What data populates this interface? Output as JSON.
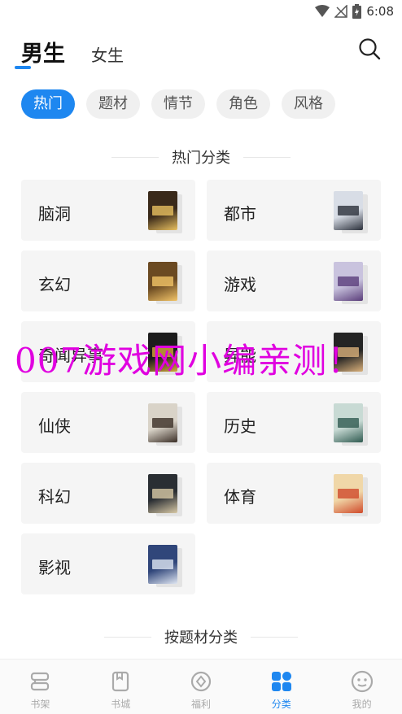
{
  "status_bar": {
    "time": "6:08",
    "icons": [
      "wifi-icon",
      "no-signal-icon",
      "battery-icon"
    ]
  },
  "header": {
    "tabs": [
      {
        "label": "男生",
        "active": true
      },
      {
        "label": "女生",
        "active": false
      }
    ],
    "search_icon": "search-icon"
  },
  "chips": [
    {
      "label": "热门",
      "active": true
    },
    {
      "label": "题材",
      "active": false
    },
    {
      "label": "情节",
      "active": false
    },
    {
      "label": "角色",
      "active": false
    },
    {
      "label": "风格",
      "active": false
    }
  ],
  "sections": {
    "hot": "热门分类",
    "by_theme": "按题材分类"
  },
  "categories": [
    {
      "label": "脑洞",
      "cover_color": "#3a2a1a",
      "cover_accent": "#e8c060"
    },
    {
      "label": "都市",
      "cover_color": "#d8dde6",
      "cover_accent": "#2a2f3a"
    },
    {
      "label": "玄幻",
      "cover_color": "#6b4a22",
      "cover_accent": "#f2c468"
    },
    {
      "label": "游戏",
      "cover_color": "#c9c3de",
      "cover_accent": "#5a3d7a"
    },
    {
      "label": "奇闻异事",
      "cover_color": "#1c1c1c",
      "cover_accent": "#d4a83a"
    },
    {
      "label": "异能",
      "cover_color": "#242424",
      "cover_accent": "#d9b07a"
    },
    {
      "label": "仙侠",
      "cover_color": "#d9d3c8",
      "cover_accent": "#3a2e26"
    },
    {
      "label": "历史",
      "cover_color": "#c8dad4",
      "cover_accent": "#2f5a50"
    },
    {
      "label": "科幻",
      "cover_color": "#2a2e33",
      "cover_accent": "#d8c9a6"
    },
    {
      "label": "体育",
      "cover_color": "#f0d7a8",
      "cover_accent": "#d04a2a"
    },
    {
      "label": "影视",
      "cover_color": "#30467a",
      "cover_accent": "#dfe6f2"
    }
  ],
  "watermark": "007游戏网小编亲测！",
  "bottom_nav": [
    {
      "label": "书架",
      "icon": "bookshelf-icon",
      "active": false
    },
    {
      "label": "书城",
      "icon": "bookstore-icon",
      "active": false
    },
    {
      "label": "福利",
      "icon": "welfare-icon",
      "active": false
    },
    {
      "label": "分类",
      "icon": "category-icon",
      "active": true
    },
    {
      "label": "我的",
      "icon": "profile-icon",
      "active": false
    }
  ],
  "colors": {
    "accent": "#1e87f0",
    "card_bg": "#f5f5f5",
    "watermark": "#e000e0"
  }
}
